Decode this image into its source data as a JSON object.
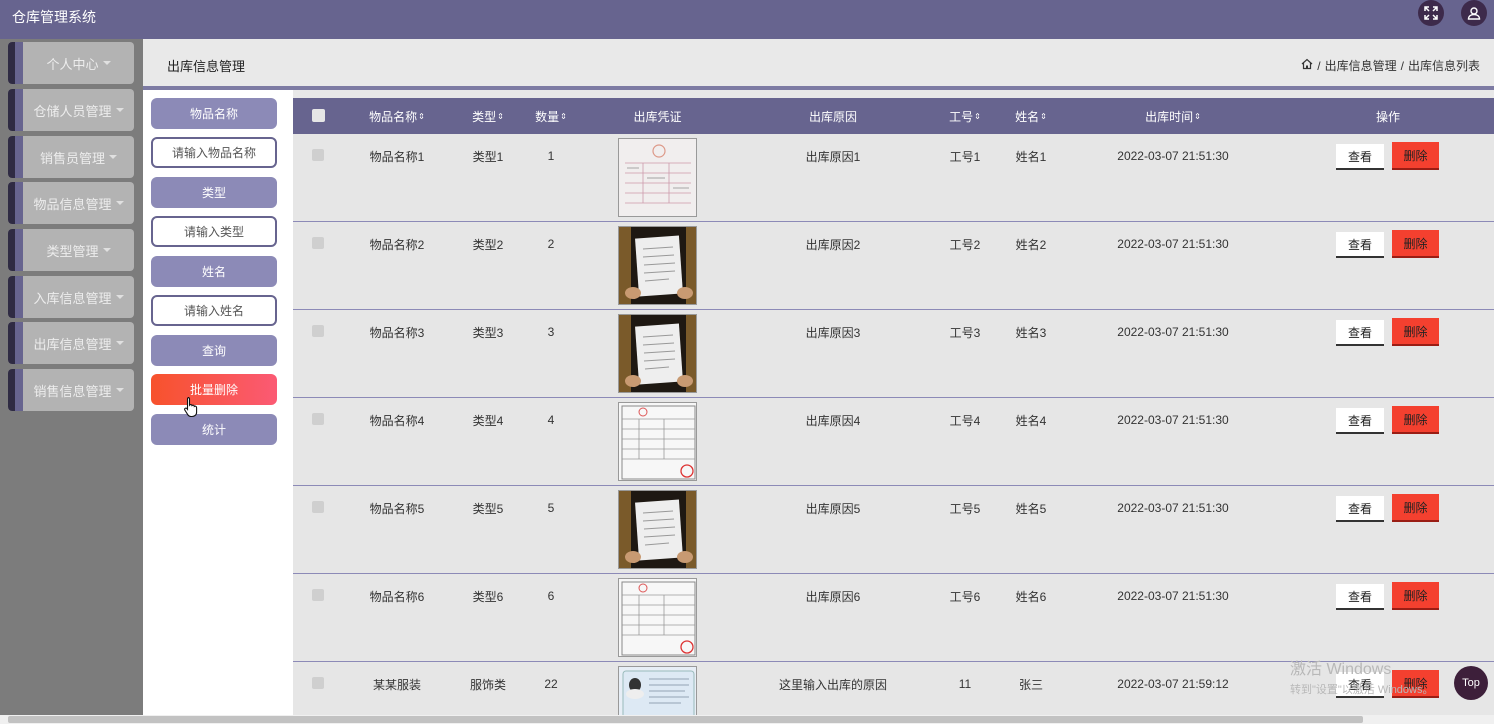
{
  "app": {
    "title": "仓库管理系统",
    "icons": {
      "fullscreen": "fullscreen-icon",
      "user": "user-icon"
    }
  },
  "sidebar": {
    "items": [
      {
        "label": "个人中心"
      },
      {
        "label": "仓储人员管理"
      },
      {
        "label": "销售员管理"
      },
      {
        "label": "物品信息管理"
      },
      {
        "label": "类型管理"
      },
      {
        "label": "入库信息管理"
      },
      {
        "label": "出库信息管理"
      },
      {
        "label": "销售信息管理"
      }
    ]
  },
  "header": {
    "page_title": "出库信息管理",
    "breadcrumb": [
      "出库信息管理",
      "出库信息列表"
    ],
    "separator": "/"
  },
  "search": {
    "item_name_label": "物品名称",
    "item_name_placeholder": "请输入物品名称",
    "type_label": "类型",
    "type_placeholder": "请输入类型",
    "name_label": "姓名",
    "name_placeholder": "请输入姓名",
    "query_label": "查询",
    "batch_delete_label": "批量删除",
    "stats_label": "统计"
  },
  "table": {
    "sort_glyph": "⇕",
    "columns": {
      "item_name": "物品名称",
      "type": "类型",
      "quantity": "数量",
      "voucher": "出库凭证",
      "reason": "出库原因",
      "job_no": "工号",
      "name": "姓名",
      "time": "出库时间",
      "actions": "操作"
    },
    "view_label": "查看",
    "delete_label": "删除",
    "rows": [
      {
        "item_name": "物品名称1",
        "type": "类型1",
        "quantity": "1",
        "voucher": "invoice",
        "reason": "出库原因1",
        "job_no": "工号1",
        "name": "姓名1",
        "time": "2022-03-07 21:51:30"
      },
      {
        "item_name": "物品名称2",
        "type": "类型2",
        "quantity": "2",
        "voucher": "held-paper",
        "reason": "出库原因2",
        "job_no": "工号2",
        "name": "姓名2",
        "time": "2022-03-07 21:51:30"
      },
      {
        "item_name": "物品名称3",
        "type": "类型3",
        "quantity": "3",
        "voucher": "held-paper",
        "reason": "出库原因3",
        "job_no": "工号3",
        "name": "姓名3",
        "time": "2022-03-07 21:51:30"
      },
      {
        "item_name": "物品名称4",
        "type": "类型4",
        "quantity": "4",
        "voucher": "form",
        "reason": "出库原因4",
        "job_no": "工号4",
        "name": "姓名4",
        "time": "2022-03-07 21:51:30"
      },
      {
        "item_name": "物品名称5",
        "type": "类型5",
        "quantity": "5",
        "voucher": "held-paper",
        "reason": "出库原因5",
        "job_no": "工号5",
        "name": "姓名5",
        "time": "2022-03-07 21:51:30"
      },
      {
        "item_name": "物品名称6",
        "type": "类型6",
        "quantity": "6",
        "voucher": "form",
        "reason": "出库原因6",
        "job_no": "工号6",
        "name": "姓名6",
        "time": "2022-03-07 21:51:30"
      },
      {
        "item_name": "某某服装",
        "type": "服饰类",
        "quantity": "22",
        "voucher": "id-card",
        "reason": "这里输入出库的原因",
        "job_no": "11",
        "name": "张三",
        "time": "2022-03-07 21:59:12"
      }
    ]
  },
  "overlay": {
    "watermark_line1": "激活 Windows",
    "watermark_line2": "转到\"设置\"以激活 Windows。",
    "top_label": "Top"
  },
  "colors": {
    "primary": "#67648f",
    "primary_light": "#8c8ab7",
    "danger": "#f4402f",
    "sidebar_bg": "#7c7c7c"
  }
}
